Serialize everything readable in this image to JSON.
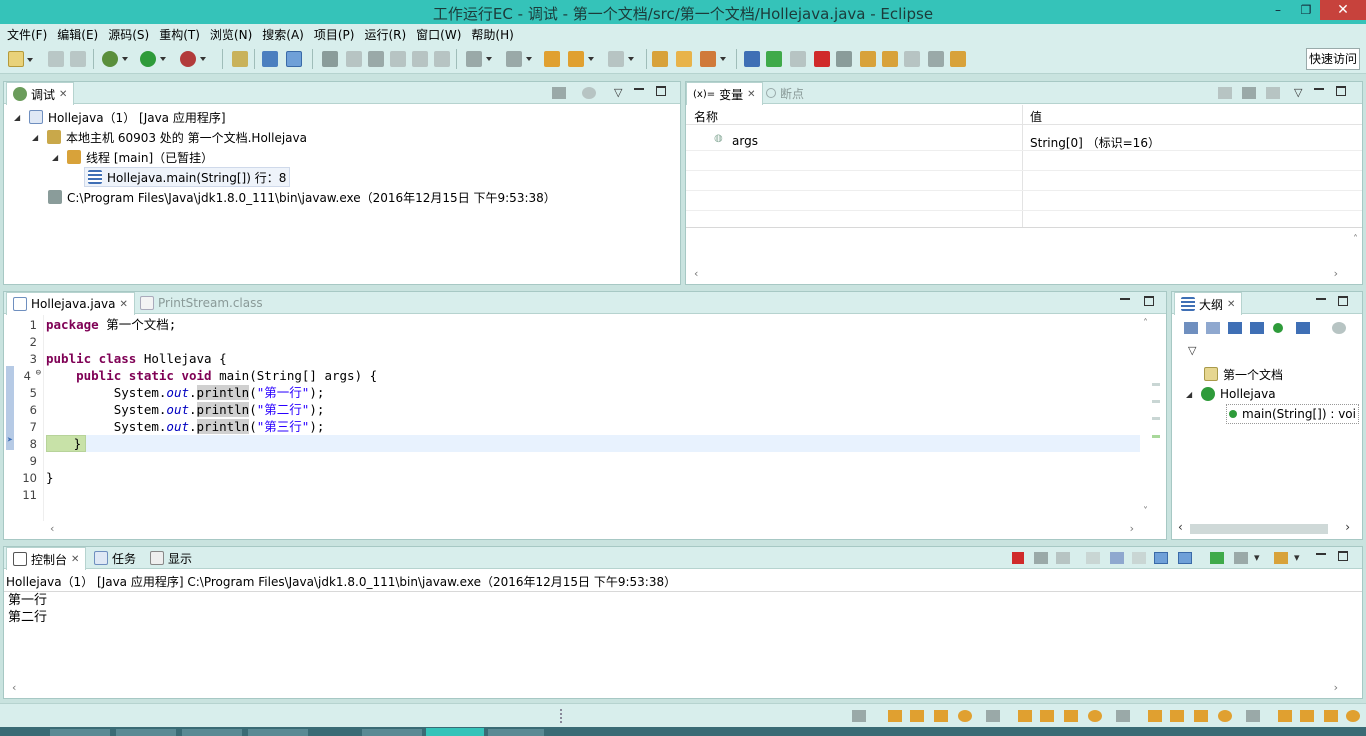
{
  "window": {
    "title": "工作运行EC  -  调试  -  第一个文档/src/第一个文档/Hollejava.java  -  Eclipse",
    "minimize": "–",
    "restore": "❐",
    "close": "✕"
  },
  "menu": [
    "文件(F)",
    "编辑(E)",
    "源码(S)",
    "重构(T)",
    "浏览(N)",
    "搜索(A)",
    "项目(P)",
    "运行(R)",
    "窗口(W)",
    "帮助(H)"
  ],
  "toolbar": {
    "quick_access": "快速访问"
  },
  "debug_view": {
    "tab_label": "调试",
    "tree": [
      {
        "label": "Hollejava（1） [Java 应用程序]"
      },
      {
        "label": "本地主机 60903 处的 第一个文档.Hollejava"
      },
      {
        "label": "线程 [main]（已暂挂）"
      },
      {
        "label": "Hollejava.main(String[]) 行：8"
      },
      {
        "label": "C:\\Program Files\\Java\\jdk1.8.0_111\\bin\\javaw.exe（2016年12月15日 下午9:53:38）"
      }
    ]
  },
  "variables_view": {
    "tab_label": "变量",
    "tab2_label": "断点",
    "col_name": "名称",
    "col_value": "值",
    "rows": [
      {
        "name": "args",
        "value": "String[0]  （标识=16）"
      }
    ]
  },
  "editor": {
    "tabs": [
      {
        "label": "Hollejava.java"
      },
      {
        "label": "PrintStream.class"
      }
    ],
    "line_numbers": [
      "1",
      "2",
      "3",
      "4",
      "5",
      "6",
      "7",
      "8",
      "9",
      "10",
      "11"
    ],
    "code": {
      "l1_kw": "package",
      "l1_rest": " 第一个文档;",
      "l3_kw": "public class",
      "l3_rest": " Hollejava {",
      "l4_kw1": "public static void",
      "l4_rest": " main(String[] args) {",
      "sys": "System.",
      "out": "out",
      "println": "println",
      "s1": "\"第一行\"",
      "s2": "\"第二行\"",
      "s3": "\"第三行\"",
      "tail": ");",
      "open": "(",
      "close_brace": "}",
      "class_close": "}"
    }
  },
  "outline_view": {
    "tab_label": "大纲",
    "items": [
      {
        "label": "第一个文档"
      },
      {
        "label": "Hollejava"
      },
      {
        "label": "main(String[]) : voi"
      }
    ]
  },
  "console_view": {
    "tabs": [
      {
        "label": "控制台"
      },
      {
        "label": "任务"
      },
      {
        "label": "显示"
      }
    ],
    "header": "Hollejava（1） [Java 应用程序] C:\\Program Files\\Java\\jdk1.8.0_111\\bin\\javaw.exe（2016年12月15日 下午9:53:38）",
    "output": [
      "第一行",
      "第二行"
    ]
  },
  "colors": {
    "titlebar": "#35c3b9",
    "chrome": "#d8eeec",
    "close": "#c7423c"
  }
}
